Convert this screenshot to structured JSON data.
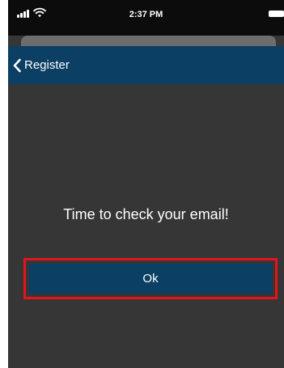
{
  "status_bar": {
    "time": "2:37 PM",
    "icons": [
      "signal-icon",
      "wifi-icon",
      "battery-icon"
    ]
  },
  "nav": {
    "back_label": "Register",
    "back_icon": "chevron-left-icon"
  },
  "main": {
    "message": "Time to check your email!",
    "ok_label": "Ok"
  },
  "colors": {
    "background": "#363636",
    "nav": "#0b3f63",
    "button": "#0b3f63",
    "highlight_border": "#e3141b"
  }
}
